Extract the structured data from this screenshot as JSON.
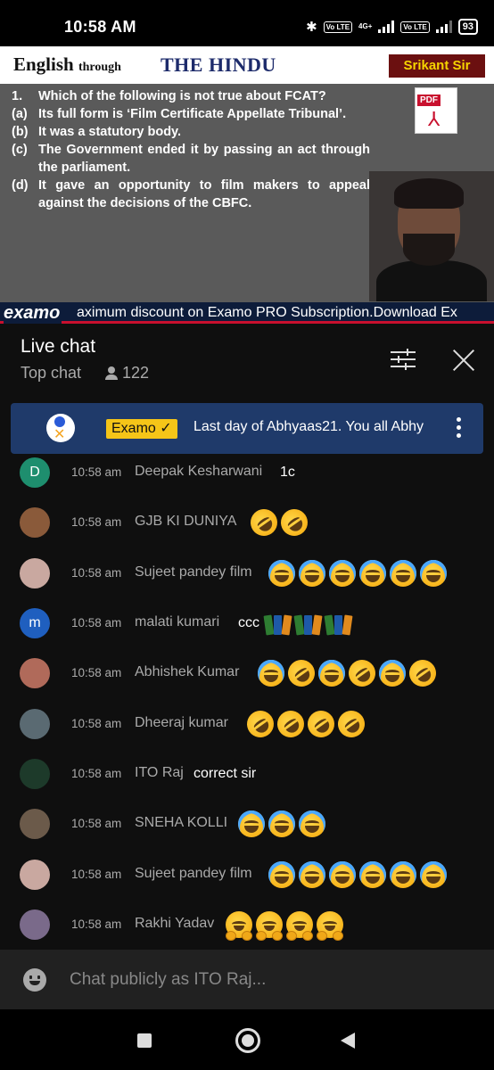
{
  "status_bar": {
    "time": "10:58 AM",
    "network": "4G+",
    "volte1": "Vo LTE",
    "volte2": "Vo LTE",
    "battery": "93"
  },
  "video": {
    "banner": {
      "english": "English",
      "through": "through",
      "hindu": "THE HINDU",
      "teacher": "Srikant Sir"
    },
    "question": {
      "number": "1.",
      "text": "Which of the following is not true about FCAT?",
      "options": [
        {
          "label": "(a)",
          "text": "Its full form is ‘Film Certificate Appellate Tribunal’."
        },
        {
          "label": "(b)",
          "text": "It was a statutory body."
        },
        {
          "label": "(c)",
          "text": "The Government ended it by passing an act through the parliament."
        },
        {
          "label": "(d)",
          "text": "It gave an opportunity to film makers to appeal against the decisions of the CBFC."
        }
      ]
    },
    "pdf_label": "PDF",
    "ticker": {
      "logo": "examo",
      "text": "aximum discount on Examo PRO Subscription.Download Ex"
    }
  },
  "chat_header": {
    "title": "Live chat",
    "mode": "Top chat",
    "viewer_count": "122",
    "icons": [
      "person-icon",
      "filter-icon",
      "close-icon"
    ]
  },
  "pinned": {
    "author": "Examo ✓",
    "message": "Last day of Abhyaas21. You all Abhy"
  },
  "messages": [
    {
      "time": "10:58 am",
      "author": "Deepak Kesharwani",
      "text": "1c",
      "avatar_letter": "D",
      "avatar_color": "#1e8e6e",
      "emojis": []
    },
    {
      "time": "10:58 am",
      "author": "GJB KI DUNIYA",
      "text": "",
      "avatar_letter": "",
      "avatar_color": "#8a5a3a",
      "emojis": [
        "rofl",
        "rofl"
      ]
    },
    {
      "time": "10:58 am",
      "author": "Sujeet pandey film",
      "text": "",
      "avatar_letter": "",
      "avatar_color": "#c9a8a0",
      "emojis": [
        "joy",
        "joy",
        "joy",
        "joy",
        "joy",
        "joy"
      ]
    },
    {
      "time": "10:58 am",
      "author": "malati kumari",
      "text": "ccc",
      "avatar_letter": "m",
      "avatar_color": "#1f5fbf",
      "emojis": [
        "books",
        "books",
        "books"
      ]
    },
    {
      "time": "10:58 am",
      "author": "Abhishek Kumar",
      "text": "",
      "avatar_letter": "",
      "avatar_color": "#b06a5a",
      "emojis": [
        "joy",
        "rofl",
        "joy",
        "rofl",
        "joy",
        "rofl"
      ]
    },
    {
      "time": "10:58 am",
      "author": "Dheeraj kumar",
      "text": "",
      "avatar_letter": "",
      "avatar_color": "#5a6a72",
      "emojis": [
        "rofl",
        "rofl",
        "rofl",
        "rofl"
      ]
    },
    {
      "time": "10:58 am",
      "author": "ITO Raj",
      "text": "correct sir",
      "avatar_letter": "",
      "avatar_color": "#1d3a2a",
      "emojis": []
    },
    {
      "time": "10:58 am",
      "author": "SNEHA KOLLI",
      "text": "",
      "avatar_letter": "",
      "avatar_color": "#6b5a4a",
      "emojis": [
        "joy",
        "joy",
        "joy"
      ]
    },
    {
      "time": "10:58 am",
      "author": "Sujeet pandey film",
      "text": "",
      "avatar_letter": "",
      "avatar_color": "#c9a8a0",
      "emojis": [
        "joy",
        "joy",
        "joy",
        "joy",
        "joy",
        "joy"
      ]
    },
    {
      "time": "10:58 am",
      "author": "Rakhi Yadav",
      "text": "",
      "avatar_letter": "",
      "avatar_color": "#7a6a8a",
      "emojis": [
        "hug",
        "hug",
        "hug",
        "hug"
      ]
    }
  ],
  "input": {
    "placeholder": "Chat publicly as ITO Raj..."
  },
  "navigation": [
    "recents-icon",
    "home-icon",
    "back-icon"
  ]
}
